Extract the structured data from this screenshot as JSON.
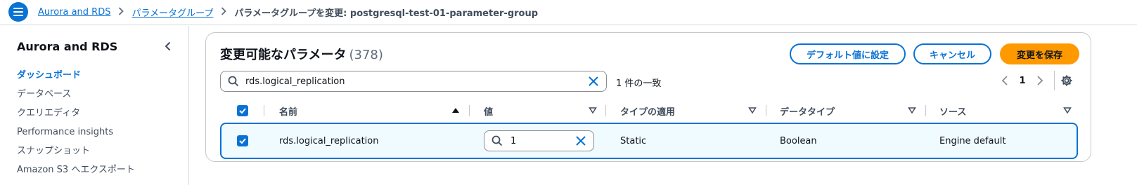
{
  "breadcrumb": {
    "items": [
      "Aurora and RDS",
      "パラメータグループ"
    ],
    "current": "パラメータグループを変更: postgresql-test-01-parameter-group"
  },
  "sidebar": {
    "title": "Aurora and RDS",
    "items": [
      {
        "label": "ダッシュボード",
        "active": true
      },
      {
        "label": "データベース"
      },
      {
        "label": "クエリエディタ"
      },
      {
        "label": "Performance insights"
      },
      {
        "label": "スナップショット"
      },
      {
        "label": "Amazon S3 へエクスポート"
      }
    ]
  },
  "panel": {
    "title": "変更可能なパラメータ",
    "count": "(378)",
    "buttons": {
      "reset": "デフォルト値に設定",
      "cancel": "キャンセル",
      "save": "変更を保存"
    },
    "search": {
      "value": "rds.logical_replication"
    },
    "match_count": "1 件の一致",
    "pagination": {
      "page": "1"
    }
  },
  "table": {
    "columns": [
      "名前",
      "値",
      "タイプの適用",
      "データタイプ",
      "ソース"
    ],
    "rows": [
      {
        "name": "rds.logical_replication",
        "value": "1",
        "apply_type": "Static",
        "data_type": "Boolean",
        "source": "Engine default",
        "selected": true
      }
    ]
  },
  "colors": {
    "accent": "#0972d3",
    "primary_button": "#ff9900",
    "row_selected_bg": "#f0fbff"
  }
}
